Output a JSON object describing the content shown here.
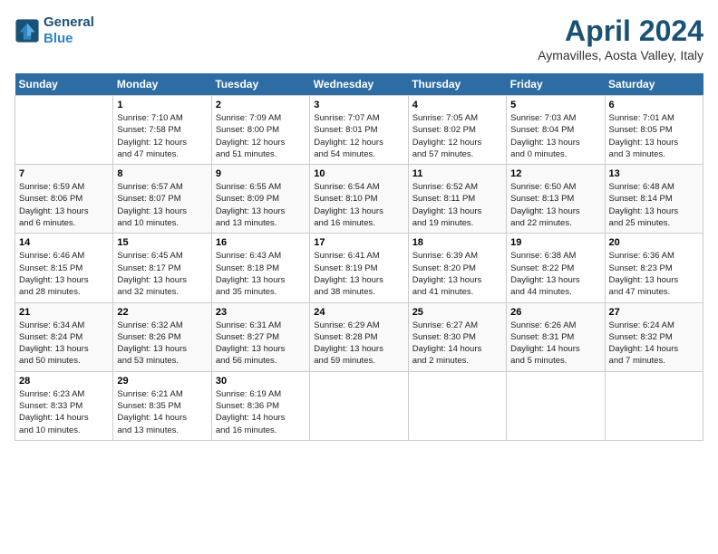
{
  "logo": {
    "line1": "General",
    "line2": "Blue"
  },
  "title": "April 2024",
  "subtitle": "Aymavilles, Aosta Valley, Italy",
  "days_header": [
    "Sunday",
    "Monday",
    "Tuesday",
    "Wednesday",
    "Thursday",
    "Friday",
    "Saturday"
  ],
  "weeks": [
    [
      {
        "num": "",
        "info": ""
      },
      {
        "num": "1",
        "info": "Sunrise: 7:10 AM\nSunset: 7:58 PM\nDaylight: 12 hours\nand 47 minutes."
      },
      {
        "num": "2",
        "info": "Sunrise: 7:09 AM\nSunset: 8:00 PM\nDaylight: 12 hours\nand 51 minutes."
      },
      {
        "num": "3",
        "info": "Sunrise: 7:07 AM\nSunset: 8:01 PM\nDaylight: 12 hours\nand 54 minutes."
      },
      {
        "num": "4",
        "info": "Sunrise: 7:05 AM\nSunset: 8:02 PM\nDaylight: 12 hours\nand 57 minutes."
      },
      {
        "num": "5",
        "info": "Sunrise: 7:03 AM\nSunset: 8:04 PM\nDaylight: 13 hours\nand 0 minutes."
      },
      {
        "num": "6",
        "info": "Sunrise: 7:01 AM\nSunset: 8:05 PM\nDaylight: 13 hours\nand 3 minutes."
      }
    ],
    [
      {
        "num": "7",
        "info": "Sunrise: 6:59 AM\nSunset: 8:06 PM\nDaylight: 13 hours\nand 6 minutes."
      },
      {
        "num": "8",
        "info": "Sunrise: 6:57 AM\nSunset: 8:07 PM\nDaylight: 13 hours\nand 10 minutes."
      },
      {
        "num": "9",
        "info": "Sunrise: 6:55 AM\nSunset: 8:09 PM\nDaylight: 13 hours\nand 13 minutes."
      },
      {
        "num": "10",
        "info": "Sunrise: 6:54 AM\nSunset: 8:10 PM\nDaylight: 13 hours\nand 16 minutes."
      },
      {
        "num": "11",
        "info": "Sunrise: 6:52 AM\nSunset: 8:11 PM\nDaylight: 13 hours\nand 19 minutes."
      },
      {
        "num": "12",
        "info": "Sunrise: 6:50 AM\nSunset: 8:13 PM\nDaylight: 13 hours\nand 22 minutes."
      },
      {
        "num": "13",
        "info": "Sunrise: 6:48 AM\nSunset: 8:14 PM\nDaylight: 13 hours\nand 25 minutes."
      }
    ],
    [
      {
        "num": "14",
        "info": "Sunrise: 6:46 AM\nSunset: 8:15 PM\nDaylight: 13 hours\nand 28 minutes."
      },
      {
        "num": "15",
        "info": "Sunrise: 6:45 AM\nSunset: 8:17 PM\nDaylight: 13 hours\nand 32 minutes."
      },
      {
        "num": "16",
        "info": "Sunrise: 6:43 AM\nSunset: 8:18 PM\nDaylight: 13 hours\nand 35 minutes."
      },
      {
        "num": "17",
        "info": "Sunrise: 6:41 AM\nSunset: 8:19 PM\nDaylight: 13 hours\nand 38 minutes."
      },
      {
        "num": "18",
        "info": "Sunrise: 6:39 AM\nSunset: 8:20 PM\nDaylight: 13 hours\nand 41 minutes."
      },
      {
        "num": "19",
        "info": "Sunrise: 6:38 AM\nSunset: 8:22 PM\nDaylight: 13 hours\nand 44 minutes."
      },
      {
        "num": "20",
        "info": "Sunrise: 6:36 AM\nSunset: 8:23 PM\nDaylight: 13 hours\nand 47 minutes."
      }
    ],
    [
      {
        "num": "21",
        "info": "Sunrise: 6:34 AM\nSunset: 8:24 PM\nDaylight: 13 hours\nand 50 minutes."
      },
      {
        "num": "22",
        "info": "Sunrise: 6:32 AM\nSunset: 8:26 PM\nDaylight: 13 hours\nand 53 minutes."
      },
      {
        "num": "23",
        "info": "Sunrise: 6:31 AM\nSunset: 8:27 PM\nDaylight: 13 hours\nand 56 minutes."
      },
      {
        "num": "24",
        "info": "Sunrise: 6:29 AM\nSunset: 8:28 PM\nDaylight: 13 hours\nand 59 minutes."
      },
      {
        "num": "25",
        "info": "Sunrise: 6:27 AM\nSunset: 8:30 PM\nDaylight: 14 hours\nand 2 minutes."
      },
      {
        "num": "26",
        "info": "Sunrise: 6:26 AM\nSunset: 8:31 PM\nDaylight: 14 hours\nand 5 minutes."
      },
      {
        "num": "27",
        "info": "Sunrise: 6:24 AM\nSunset: 8:32 PM\nDaylight: 14 hours\nand 7 minutes."
      }
    ],
    [
      {
        "num": "28",
        "info": "Sunrise: 6:23 AM\nSunset: 8:33 PM\nDaylight: 14 hours\nand 10 minutes."
      },
      {
        "num": "29",
        "info": "Sunrise: 6:21 AM\nSunset: 8:35 PM\nDaylight: 14 hours\nand 13 minutes."
      },
      {
        "num": "30",
        "info": "Sunrise: 6:19 AM\nSunset: 8:36 PM\nDaylight: 14 hours\nand 16 minutes."
      },
      {
        "num": "",
        "info": ""
      },
      {
        "num": "",
        "info": ""
      },
      {
        "num": "",
        "info": ""
      },
      {
        "num": "",
        "info": ""
      }
    ]
  ]
}
